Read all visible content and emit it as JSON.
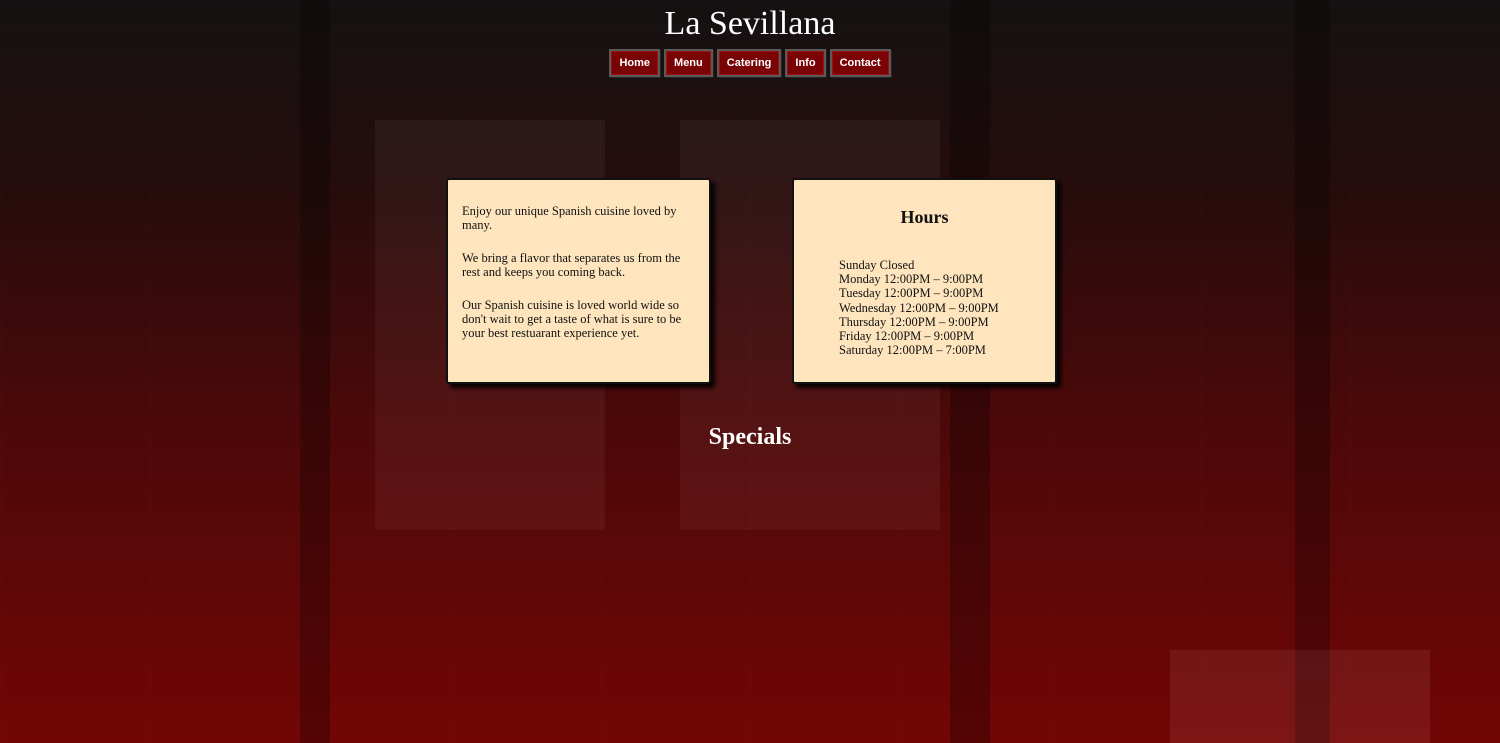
{
  "site": {
    "title": "La Sevillana"
  },
  "nav": {
    "items": [
      {
        "label": "Home"
      },
      {
        "label": "Menu"
      },
      {
        "label": "Catering"
      },
      {
        "label": "Info"
      },
      {
        "label": "Contact"
      }
    ]
  },
  "about": {
    "paragraphs": [
      "Enjoy our unique Spanish cuisine loved by many.",
      "We bring a flavor that separates us from the rest and keeps you coming back.",
      "Our Spanish cuisine is loved world wide so don't wait to get a taste of what is sure to be your best restuarant experience yet."
    ]
  },
  "hours": {
    "title": "Hours",
    "lines": [
      "Sunday Closed",
      "Monday 12:00PM – 9:00PM",
      "Tuesday 12:00PM – 9:00PM",
      "Wednesday 12:00PM – 9:00PM",
      "Thursday 12:00PM – 9:00PM",
      "Friday 12:00PM – 9:00PM",
      "Saturday 12:00PM – 7:00PM"
    ]
  },
  "specials": {
    "title": "Specials"
  },
  "colors": {
    "accent": "#7a0306",
    "card_background": "#fee5bd",
    "text_light": "#ffffff"
  }
}
